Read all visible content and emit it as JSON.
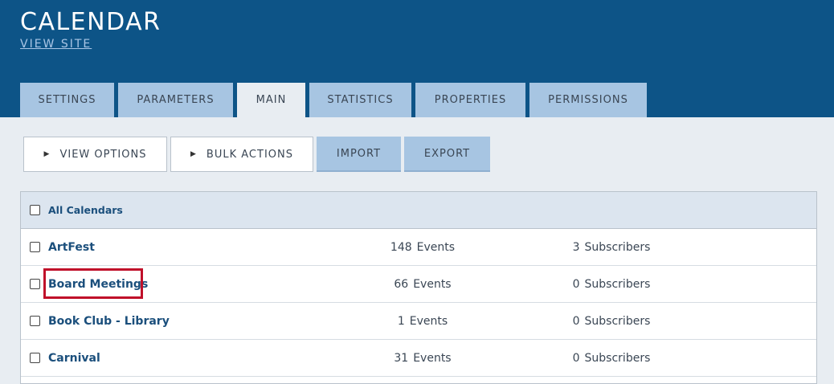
{
  "header": {
    "title": "CALENDAR",
    "view_site": "VIEW SITE"
  },
  "tabs": [
    {
      "label": "SETTINGS",
      "active": false
    },
    {
      "label": "PARAMETERS",
      "active": false
    },
    {
      "label": "MAIN",
      "active": true
    },
    {
      "label": "STATISTICS",
      "active": false
    },
    {
      "label": "PROPERTIES",
      "active": false
    },
    {
      "label": "PERMISSIONS",
      "active": false
    }
  ],
  "toolbar": {
    "view_options": "VIEW OPTIONS",
    "bulk_actions": "BULK ACTIONS",
    "import": "IMPORT",
    "export": "EXPORT",
    "arrow_glyph": "▶"
  },
  "table": {
    "header_label": "All Calendars",
    "events_suffix": "Events",
    "subscribers_suffix": "Subscribers",
    "rows": [
      {
        "name": "ArtFest",
        "events": "148",
        "subscribers": "3"
      },
      {
        "name": "Board Meetings",
        "events": "66",
        "subscribers": "0",
        "highlighted": true
      },
      {
        "name": "Book Club - Library",
        "events": "1",
        "subscribers": "0"
      },
      {
        "name": "Carnival",
        "events": "31",
        "subscribers": "0"
      }
    ]
  },
  "colors": {
    "header_bg": "#0d5487",
    "tab_bg": "#a7c5e2",
    "page_bg": "#e8edf2",
    "link": "#1b4f7c",
    "highlight": "#c0102a"
  }
}
